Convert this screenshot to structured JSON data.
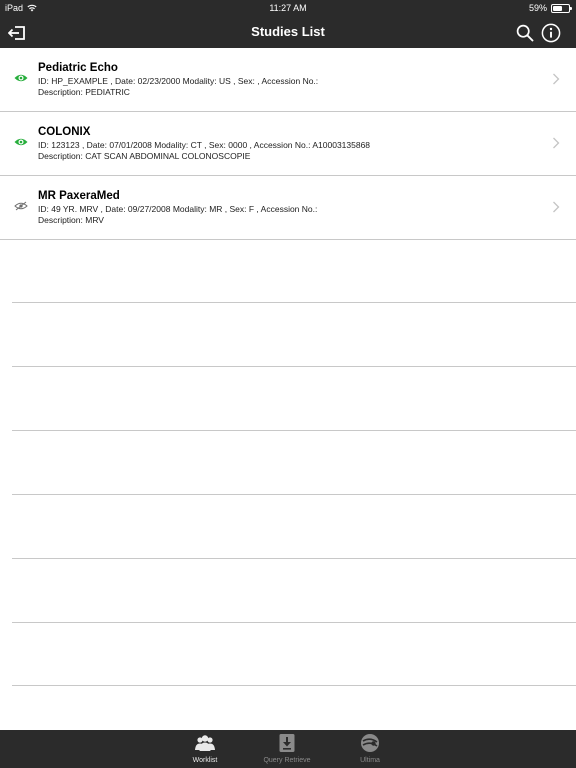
{
  "status_bar": {
    "device": "iPad",
    "time": "11:27 AM",
    "battery": "59%",
    "battery_level": 0.59
  },
  "nav": {
    "title": "Studies List",
    "icons": [
      "logout-icon",
      "search-icon",
      "info-icon"
    ]
  },
  "studies": [
    {
      "title": "Pediatric Echo",
      "line1": "ID: HP_EXAMPLE , Date: 02/23/2000 Modality: US  , Sex:   , Accession No.:",
      "line2": "Description:   PEDIATRIC",
      "viewed": true
    },
    {
      "title": "COLONIX",
      "line1": "ID: 123123  , Date: 07/01/2008 Modality: CT  , Sex: 0000  , Accession No.: A10003135868",
      "line2": "Description:   CAT SCAN ABDOMINAL COLONOSCOPIE",
      "viewed": true
    },
    {
      "title": "MR PaxeraMed",
      "line1": "ID: 49 YR. MRV , Date: 09/27/2008 Modality: MR  , Sex: F  , Accession No.:",
      "line2": "Description:   MRV",
      "viewed": false
    }
  ],
  "colors": {
    "bar_background": "#2b2b2b",
    "viewed_eye": "#27ae3c",
    "unviewed_eye": "#6e6e6e",
    "separator": "#c8c8c8"
  },
  "tabs": [
    {
      "label": "Worklist",
      "icon": "users-icon",
      "active": true
    },
    {
      "label": "Query Retrieve",
      "icon": "download-icon",
      "active": false
    },
    {
      "label": "Ultima",
      "icon": "ultima-icon",
      "active": false
    }
  ]
}
